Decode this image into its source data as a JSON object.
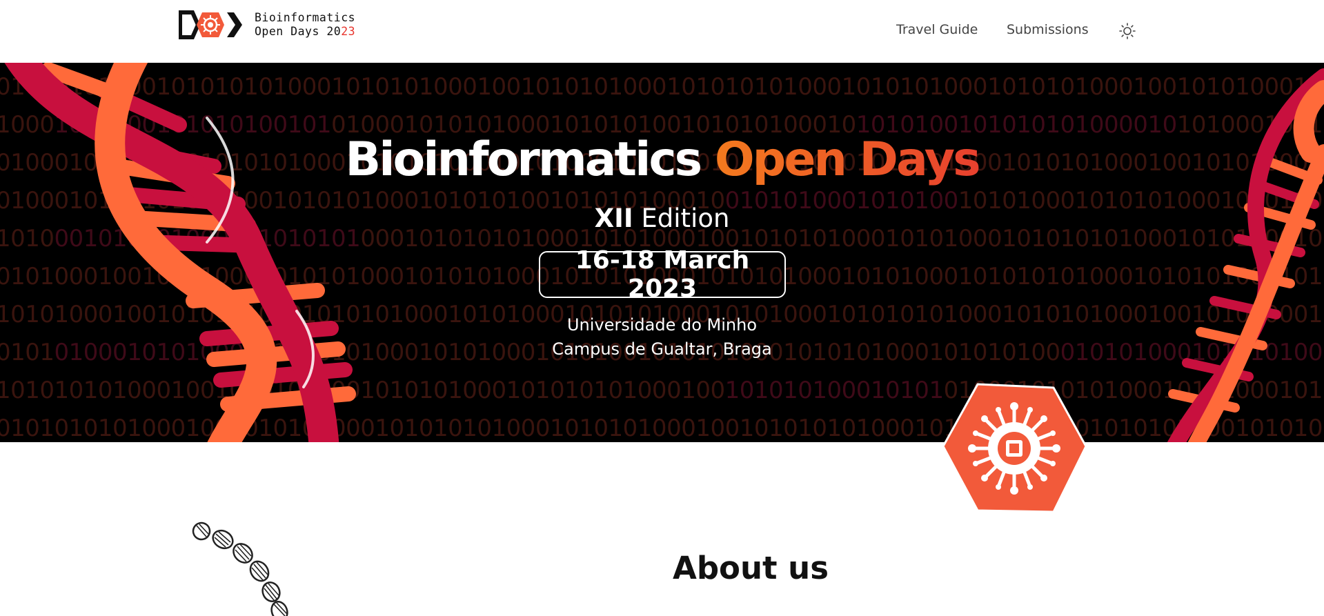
{
  "header": {
    "logo_line1": "Bioinformatics",
    "logo_line2_prefix": "Open Days 20",
    "logo_line2_accent": "23",
    "nav": [
      {
        "label": "Travel Guide"
      },
      {
        "label": "Submissions"
      }
    ],
    "theme_toggle_icon": "sun-icon"
  },
  "hero": {
    "title_white": "Bioinformatics",
    "title_accent": "Open Days",
    "edition_bold": "XII",
    "edition_rest": "Edition",
    "date": "16-18 March 2023",
    "venue_line1": "Universidade do Minho",
    "venue_line2": "Campus de Gualtar, Braga"
  },
  "about": {
    "title": "About us"
  },
  "colors": {
    "accent_orange": "#f47a1e",
    "accent_red": "#e8402e",
    "dna_red": "#c8103e",
    "dna_orange": "#ff6a3a",
    "badge": "#f25a3a"
  }
}
